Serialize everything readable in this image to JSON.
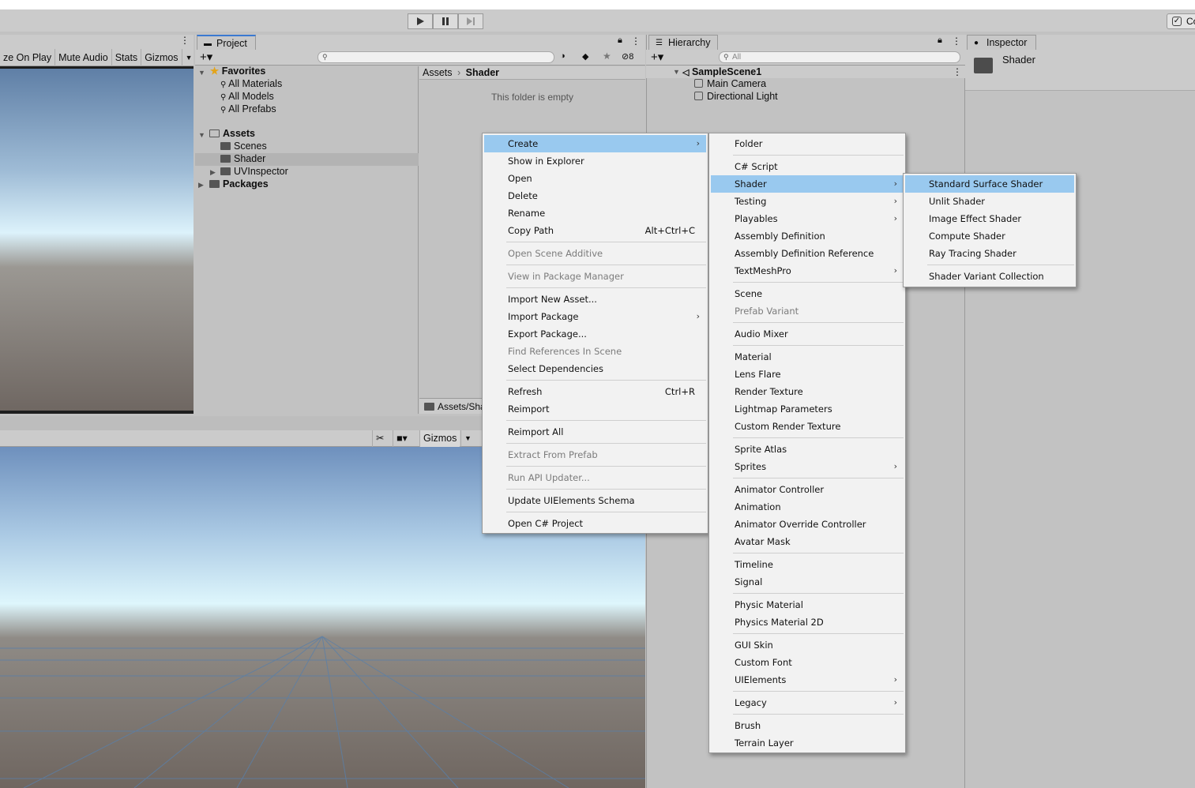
{
  "toolbar": {
    "collab_label": "Co"
  },
  "game": {
    "items": [
      "ze On Play",
      "Mute Audio",
      "Stats",
      "Gizmos"
    ]
  },
  "project": {
    "tab": "Project",
    "hidden_count": "8",
    "favorites": {
      "label": "Favorites",
      "items": [
        "All Materials",
        "All Models",
        "All Prefabs"
      ]
    },
    "assets": {
      "label": "Assets",
      "children": [
        "Scenes",
        "Shader",
        "UVInspector"
      ]
    },
    "packages": "Packages",
    "breadcrumb": {
      "root": "Assets",
      "current": "Shader"
    },
    "empty_text": "This folder is empty",
    "footer_path": "Assets/Sha"
  },
  "scene": {
    "gizmos": "Gizmos"
  },
  "hierarchy": {
    "tab": "Hierarchy",
    "search_placeholder": "All",
    "scene_name": "SampleScene1",
    "objects": [
      "Main Camera",
      "Directional Light"
    ]
  },
  "inspector": {
    "tab": "Inspector",
    "selected": "Shader"
  },
  "menu_main": [
    {
      "label": "Create",
      "arrow": true,
      "highlight": true
    },
    {
      "label": "Show in Explorer"
    },
    {
      "label": "Open"
    },
    {
      "label": "Delete"
    },
    {
      "label": "Rename"
    },
    {
      "label": "Copy Path",
      "shortcut": "Alt+Ctrl+C"
    },
    {
      "sep": true
    },
    {
      "label": "Open Scene Additive",
      "disabled": true
    },
    {
      "sep": true
    },
    {
      "label": "View in Package Manager",
      "disabled": true
    },
    {
      "sep": true
    },
    {
      "label": "Import New Asset..."
    },
    {
      "label": "Import Package",
      "arrow": true
    },
    {
      "label": "Export Package..."
    },
    {
      "label": "Find References In Scene",
      "disabled": true
    },
    {
      "label": "Select Dependencies"
    },
    {
      "sep": true
    },
    {
      "label": "Refresh",
      "shortcut": "Ctrl+R"
    },
    {
      "label": "Reimport"
    },
    {
      "sep": true
    },
    {
      "label": "Reimport All"
    },
    {
      "sep": true
    },
    {
      "label": "Extract From Prefab",
      "disabled": true
    },
    {
      "sep": true
    },
    {
      "label": "Run API Updater...",
      "disabled": true
    },
    {
      "sep": true
    },
    {
      "label": "Update UIElements Schema"
    },
    {
      "sep": true
    },
    {
      "label": "Open C# Project"
    }
  ],
  "menu_create": [
    {
      "label": "Folder"
    },
    {
      "sep": true
    },
    {
      "label": "C# Script"
    },
    {
      "label": "Shader",
      "arrow": true,
      "highlight": true
    },
    {
      "label": "Testing",
      "arrow": true
    },
    {
      "label": "Playables",
      "arrow": true
    },
    {
      "label": "Assembly Definition"
    },
    {
      "label": "Assembly Definition Reference"
    },
    {
      "label": "TextMeshPro",
      "arrow": true
    },
    {
      "sep": true
    },
    {
      "label": "Scene"
    },
    {
      "label": "Prefab Variant",
      "disabled": true
    },
    {
      "sep": true
    },
    {
      "label": "Audio Mixer"
    },
    {
      "sep": true
    },
    {
      "label": "Material"
    },
    {
      "label": "Lens Flare"
    },
    {
      "label": "Render Texture"
    },
    {
      "label": "Lightmap Parameters"
    },
    {
      "label": "Custom Render Texture"
    },
    {
      "sep": true
    },
    {
      "label": "Sprite Atlas"
    },
    {
      "label": "Sprites",
      "arrow": true
    },
    {
      "sep": true
    },
    {
      "label": "Animator Controller"
    },
    {
      "label": "Animation"
    },
    {
      "label": "Animator Override Controller"
    },
    {
      "label": "Avatar Mask"
    },
    {
      "sep": true
    },
    {
      "label": "Timeline"
    },
    {
      "label": "Signal"
    },
    {
      "sep": true
    },
    {
      "label": "Physic Material"
    },
    {
      "label": "Physics Material 2D"
    },
    {
      "sep": true
    },
    {
      "label": "GUI Skin"
    },
    {
      "label": "Custom Font"
    },
    {
      "label": "UIElements",
      "arrow": true
    },
    {
      "sep": true
    },
    {
      "label": "Legacy",
      "arrow": true
    },
    {
      "sep": true
    },
    {
      "label": "Brush"
    },
    {
      "label": "Terrain Layer"
    }
  ],
  "menu_shader": [
    {
      "label": "Standard Surface Shader",
      "highlight": true
    },
    {
      "label": "Unlit Shader"
    },
    {
      "label": "Image Effect Shader"
    },
    {
      "label": "Compute Shader"
    },
    {
      "label": "Ray Tracing Shader"
    },
    {
      "sep": true
    },
    {
      "label": "Shader Variant Collection"
    }
  ]
}
